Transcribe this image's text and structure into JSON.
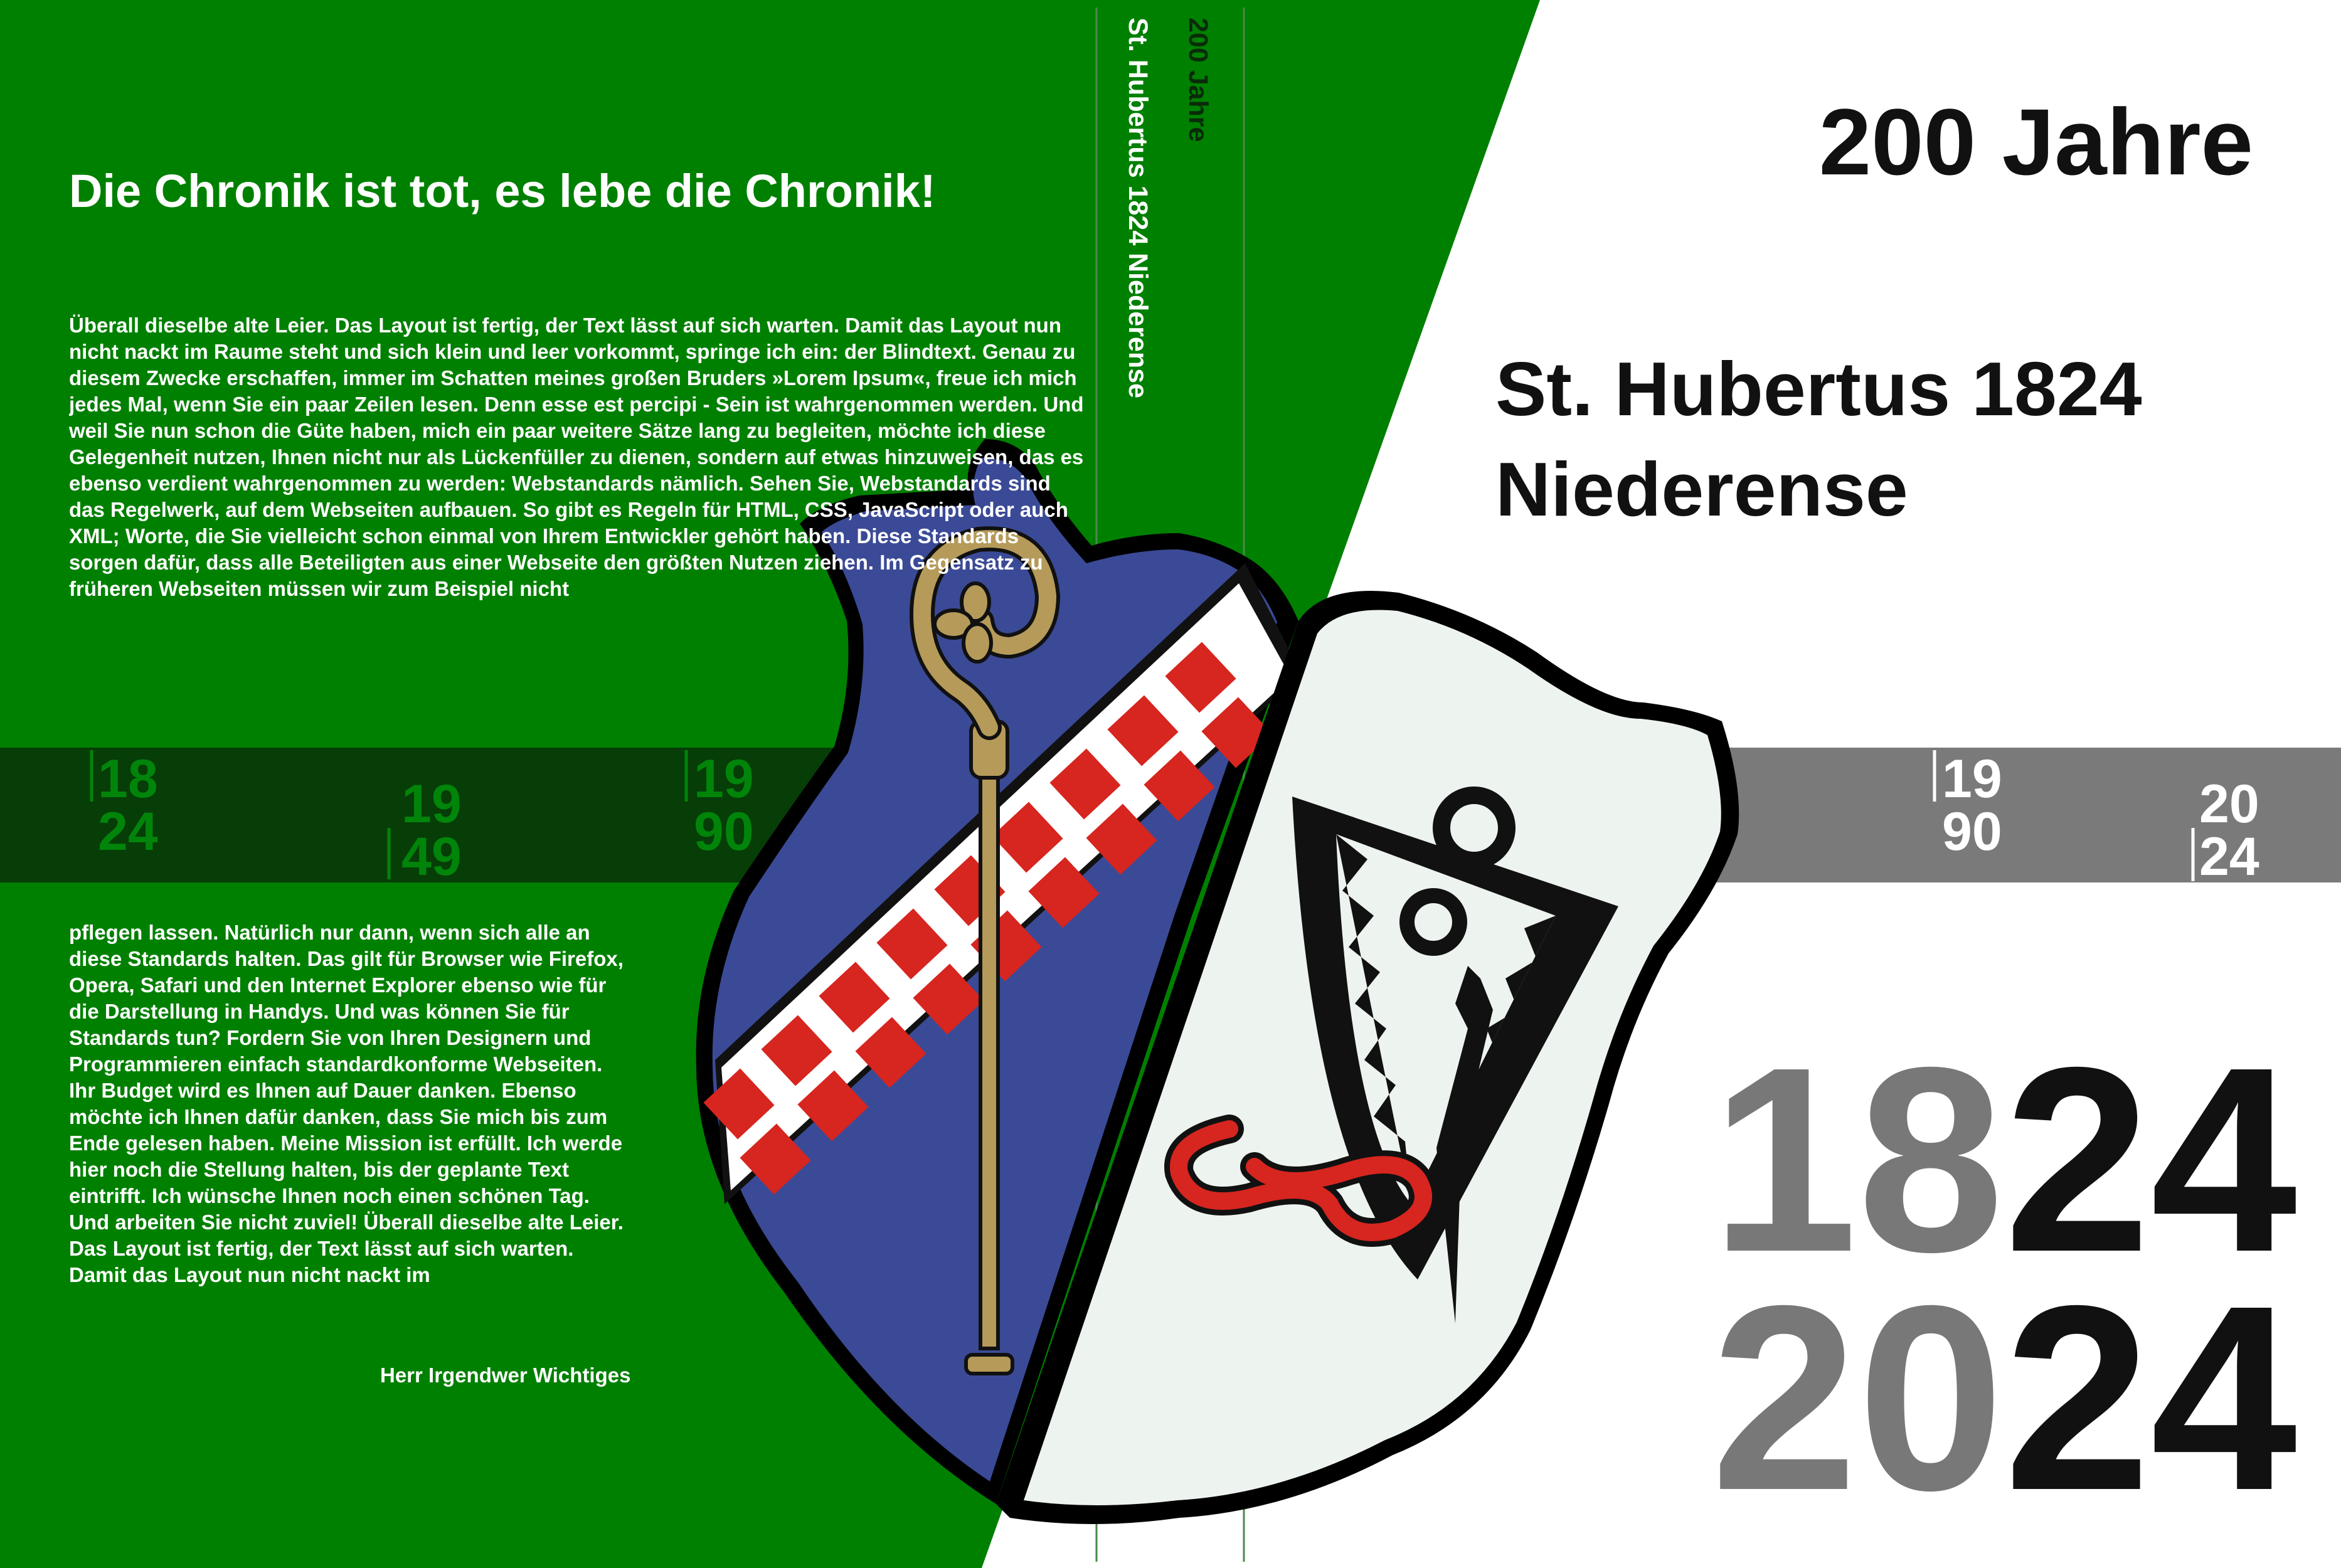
{
  "back_cover": {
    "title": "Die Chronik ist tot, es lebe die Chronik!",
    "paragraph_1": "Überall dieselbe alte Leier. Das Layout ist fertig, der Text lässt auf sich warten. Damit das Layout nun nicht nackt im Raume steht und sich klein und leer vorkommt, springe ich ein: der Blindtext. Genau zu diesem Zwecke erschaffen, immer im Schatten meines großen Bruders »Lorem Ipsum«, freue ich mich jedes Mal, wenn Sie ein paar Zeilen lesen. Denn esse est percipi - Sein ist wahrgenommen werden. Und weil Sie nun schon die Güte haben, mich ein paar weitere Sätze lang zu begleiten, möchte ich diese Gelegenheit nutzen, Ihnen nicht nur als Lückenfüller zu dienen, sondern auf etwas hinzuweisen, das es ebenso verdient wahrgenommen zu werden: Webstandards nämlich. Sehen Sie, Webstandards sind das Regelwerk, auf dem Webseiten aufbauen. So gibt es Regeln für HTML, CSS, JavaScript oder auch XML; Worte, die Sie vielleicht schon einmal von Ihrem Entwickler gehört haben. Diese Standards sorgen dafür, dass alle Beteiligten aus einer Webseite den größten Nutzen ziehen. Im Gegensatz zu früheren Webseiten müssen wir zum Beispiel nicht",
    "paragraph_2": "pflegen lassen. Natürlich nur dann, wenn sich alle an diese Standards halten. Das gilt für Browser wie Firefox, Opera, Safari und den Internet Explorer ebenso wie für die Darstellung in Handys. Und was können Sie für Standards tun? Fordern Sie von Ihren Designern und Programmieren einfach standardkonforme Webseiten. Ihr Budget wird es Ihnen auf Dauer danken. Ebenso möchte ich Ihnen dafür danken, dass Sie mich bis zum Ende gelesen haben. Meine Mission ist erfüllt. Ich werde hier noch die Stellung halten, bis der geplante Text eintrifft. Ich wünsche Ihnen noch einen schönen Tag. Und arbeiten Sie nicht zuviel! Überall dieselbe alte Leier. Das Layout ist fertig, der Text lässt auf sich warten. Damit das Layout nun nicht nackt im",
    "signature": "Herr Irgendwer Wichtiges"
  },
  "spine": {
    "line_1": "200 Jahre",
    "line_2": "St. Hubertus 1824 Niederense"
  },
  "timeline": [
    {
      "top": "18",
      "bottom": "24"
    },
    {
      "top": "19",
      "bottom": "49"
    },
    {
      "top": "19",
      "bottom": "90"
    },
    {
      "top": "19",
      "bottom": "90"
    },
    {
      "top": "20",
      "bottom": "24"
    }
  ],
  "front_cover": {
    "title": "200 Jahre",
    "club_line_1": "St. Hubertus 1824",
    "club_line_2": "Niederense",
    "year_1_part_a": "18",
    "year_1_part_b": "24",
    "year_2_part_a": "20",
    "year_2_part_b": "24"
  },
  "colors": {
    "green": "#008000",
    "dark_band": "#073d07",
    "grey_band": "#7a7a7a",
    "shield_blue": "#3b4a96",
    "checker_red": "#d7251f",
    "crozier_gold": "#b59a59",
    "shield_white": "#edf3ef"
  },
  "icons": [
    "coat-of-arms-icon",
    "crozier-icon",
    "checkered-bend-icon",
    "trident-icon",
    "serpent-icon"
  ]
}
